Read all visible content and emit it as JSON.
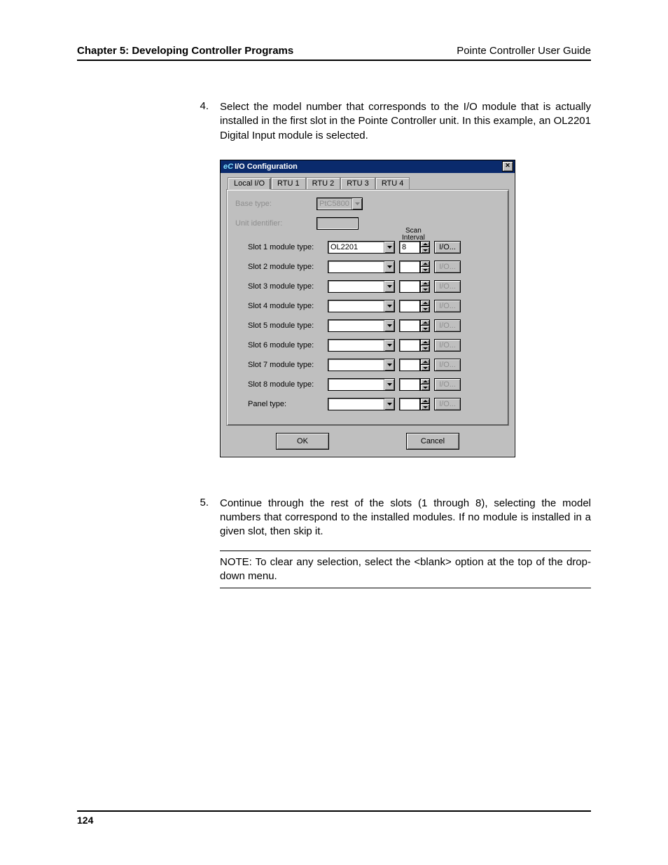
{
  "header": {
    "chapter": "Chapter 5: Developing Controller Programs",
    "guide": "Pointe Controller User Guide"
  },
  "steps": {
    "s4": {
      "num": "4.",
      "text": "Select the model number that corresponds to the I/O module that is actually installed in the first slot in the Pointe Controller unit. In this example, an OL2201 Digital Input module is selected."
    },
    "s5": {
      "num": "5.",
      "text": "Continue through the rest of the slots (1 through 8), selecting the model numbers that correspond to the installed modules. If no module is installed in a given slot, then skip it."
    }
  },
  "note": "NOTE: To clear any selection, select the <blank> option at the top of the drop-down menu.",
  "dialog": {
    "title_prefix": "eC",
    "title": "I/O Configuration",
    "tabs": [
      "Local I/O",
      "RTU 1",
      "RTU 2",
      "RTU 3",
      "RTU 4"
    ],
    "base_label": "Base type:",
    "base_value": "PtC5800",
    "unit_label": "Unit identifier:",
    "unit_value": "",
    "scan_header_l1": "Scan",
    "scan_header_l2": "Interval",
    "slots": [
      {
        "label": "Slot 1 module type:",
        "value": "OL2201",
        "scan": "8",
        "io_label": "I/O...",
        "io_enabled": true
      },
      {
        "label": "Slot 2 module type:",
        "value": "",
        "scan": "",
        "io_label": "I/O...",
        "io_enabled": false
      },
      {
        "label": "Slot 3 module type:",
        "value": "",
        "scan": "",
        "io_label": "I/O...",
        "io_enabled": false
      },
      {
        "label": "Slot 4 module type:",
        "value": "",
        "scan": "",
        "io_label": "I/O...",
        "io_enabled": false
      },
      {
        "label": "Slot 5 module type:",
        "value": "",
        "scan": "",
        "io_label": "I/O...",
        "io_enabled": false
      },
      {
        "label": "Slot 6 module type:",
        "value": "",
        "scan": "",
        "io_label": "I/O...",
        "io_enabled": false
      },
      {
        "label": "Slot 7 module type:",
        "value": "",
        "scan": "",
        "io_label": "I/O...",
        "io_enabled": false
      },
      {
        "label": "Slot 8 module type:",
        "value": "",
        "scan": "",
        "io_label": "I/O...",
        "io_enabled": false
      }
    ],
    "panel_label": "Panel type:",
    "panel_value": "",
    "panel_scan": "",
    "panel_io_label": "I/O...",
    "ok": "OK",
    "cancel": "Cancel"
  },
  "page_number": "124"
}
